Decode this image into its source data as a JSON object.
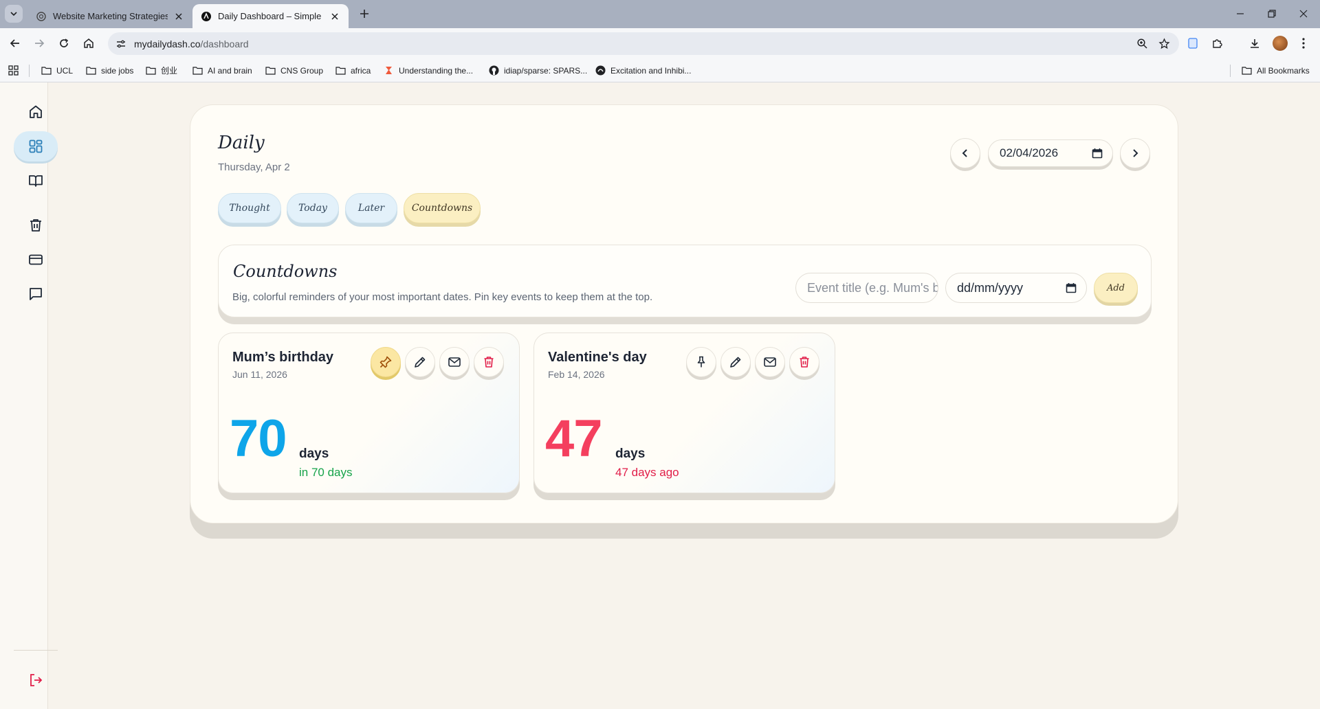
{
  "browser": {
    "tabs": [
      {
        "title": "Website Marketing Strategies",
        "active": false
      },
      {
        "title": "Daily Dashboard – Simple Life &",
        "active": true
      }
    ],
    "url_host": "mydailydash.co",
    "url_path": "/dashboard",
    "bookmarks": [
      {
        "label": "UCL",
        "icon": "folder-icon"
      },
      {
        "label": "side jobs",
        "icon": "folder-icon"
      },
      {
        "label": "创业",
        "icon": "folder-icon"
      },
      {
        "label": "AI and brain",
        "icon": "folder-icon"
      },
      {
        "label": "CNS Group",
        "icon": "folder-icon"
      },
      {
        "label": "africa",
        "icon": "folder-icon"
      },
      {
        "label": "Understanding the...",
        "icon": "bookmark-favicon-icon"
      },
      {
        "label": "idiap/sparse: SPARS...",
        "icon": "github-icon"
      },
      {
        "label": "Excitation and Inhibi...",
        "icon": "bookmark-favicon-icon"
      }
    ],
    "all_bookmarks": "All Bookmarks"
  },
  "sidebar": {
    "items": [
      {
        "name": "home",
        "icon": "home-icon"
      },
      {
        "name": "dashboard",
        "icon": "dashboard-grid-icon",
        "active": true
      },
      {
        "name": "journal",
        "icon": "book-icon"
      },
      {
        "name": "trash",
        "icon": "trash-icon"
      },
      {
        "name": "billing",
        "icon": "credit-card-icon"
      },
      {
        "name": "messages",
        "icon": "chat-icon"
      },
      {
        "name": "logout",
        "icon": "logout-icon"
      }
    ]
  },
  "header": {
    "title": "Daily",
    "subtitle": "Thursday, Apr 2",
    "date_value": "02/04/2026"
  },
  "tabs": [
    {
      "label": "Thought",
      "active": false
    },
    {
      "label": "Today",
      "active": false
    },
    {
      "label": "Later",
      "active": false
    },
    {
      "label": "Countdowns",
      "active": true
    }
  ],
  "countdowns": {
    "title": "Countdowns",
    "description": "Big, colorful reminders of your most important dates. Pin key events to keep them at the top.",
    "event_placeholder": "Event title (e.g. Mum's birthday)",
    "date_placeholder": "dd/mm/yyyy",
    "add_label": "Add",
    "items": [
      {
        "name": "Mum’s birthday",
        "date": "Jun 11, 2026",
        "number": "70",
        "unit": "days",
        "relative": "in 70 days",
        "pinned": true,
        "number_color": "#0ea5e9",
        "relative_color": "#16a34a"
      },
      {
        "name": "Valentine's day",
        "date": "Feb 14, 2026",
        "number": "47",
        "unit": "days",
        "relative": "47 days ago",
        "pinned": false,
        "number_color": "#f43f5e",
        "relative_color": "#e11d48"
      }
    ]
  },
  "colors": {
    "accent_blue": "#0ea5e9",
    "accent_red": "#f43f5e",
    "pill_yellow": "#fbefc2",
    "pill_blue": "#e3f1fa",
    "logout_red": "#e11d48"
  }
}
